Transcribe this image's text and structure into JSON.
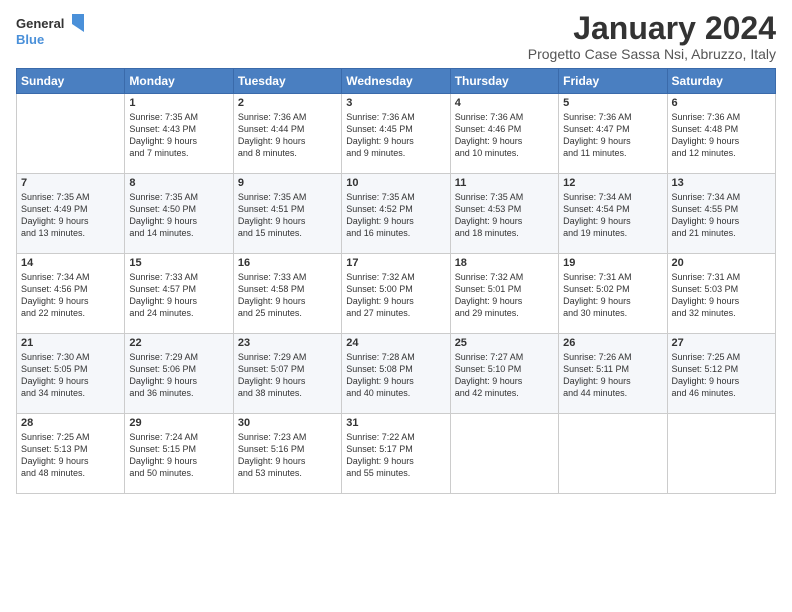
{
  "header": {
    "logo_general": "General",
    "logo_blue": "Blue",
    "title": "January 2024",
    "subtitle": "Progetto Case Sassa Nsi, Abruzzo, Italy"
  },
  "weekdays": [
    "Sunday",
    "Monday",
    "Tuesday",
    "Wednesday",
    "Thursday",
    "Friday",
    "Saturday"
  ],
  "weeks": [
    [
      {
        "day": "",
        "info": ""
      },
      {
        "day": "1",
        "info": "Sunrise: 7:35 AM\nSunset: 4:43 PM\nDaylight: 9 hours\nand 7 minutes."
      },
      {
        "day": "2",
        "info": "Sunrise: 7:36 AM\nSunset: 4:44 PM\nDaylight: 9 hours\nand 8 minutes."
      },
      {
        "day": "3",
        "info": "Sunrise: 7:36 AM\nSunset: 4:45 PM\nDaylight: 9 hours\nand 9 minutes."
      },
      {
        "day": "4",
        "info": "Sunrise: 7:36 AM\nSunset: 4:46 PM\nDaylight: 9 hours\nand 10 minutes."
      },
      {
        "day": "5",
        "info": "Sunrise: 7:36 AM\nSunset: 4:47 PM\nDaylight: 9 hours\nand 11 minutes."
      },
      {
        "day": "6",
        "info": "Sunrise: 7:36 AM\nSunset: 4:48 PM\nDaylight: 9 hours\nand 12 minutes."
      }
    ],
    [
      {
        "day": "7",
        "info": "Sunrise: 7:35 AM\nSunset: 4:49 PM\nDaylight: 9 hours\nand 13 minutes."
      },
      {
        "day": "8",
        "info": "Sunrise: 7:35 AM\nSunset: 4:50 PM\nDaylight: 9 hours\nand 14 minutes."
      },
      {
        "day": "9",
        "info": "Sunrise: 7:35 AM\nSunset: 4:51 PM\nDaylight: 9 hours\nand 15 minutes."
      },
      {
        "day": "10",
        "info": "Sunrise: 7:35 AM\nSunset: 4:52 PM\nDaylight: 9 hours\nand 16 minutes."
      },
      {
        "day": "11",
        "info": "Sunrise: 7:35 AM\nSunset: 4:53 PM\nDaylight: 9 hours\nand 18 minutes."
      },
      {
        "day": "12",
        "info": "Sunrise: 7:34 AM\nSunset: 4:54 PM\nDaylight: 9 hours\nand 19 minutes."
      },
      {
        "day": "13",
        "info": "Sunrise: 7:34 AM\nSunset: 4:55 PM\nDaylight: 9 hours\nand 21 minutes."
      }
    ],
    [
      {
        "day": "14",
        "info": "Sunrise: 7:34 AM\nSunset: 4:56 PM\nDaylight: 9 hours\nand 22 minutes."
      },
      {
        "day": "15",
        "info": "Sunrise: 7:33 AM\nSunset: 4:57 PM\nDaylight: 9 hours\nand 24 minutes."
      },
      {
        "day": "16",
        "info": "Sunrise: 7:33 AM\nSunset: 4:58 PM\nDaylight: 9 hours\nand 25 minutes."
      },
      {
        "day": "17",
        "info": "Sunrise: 7:32 AM\nSunset: 5:00 PM\nDaylight: 9 hours\nand 27 minutes."
      },
      {
        "day": "18",
        "info": "Sunrise: 7:32 AM\nSunset: 5:01 PM\nDaylight: 9 hours\nand 29 minutes."
      },
      {
        "day": "19",
        "info": "Sunrise: 7:31 AM\nSunset: 5:02 PM\nDaylight: 9 hours\nand 30 minutes."
      },
      {
        "day": "20",
        "info": "Sunrise: 7:31 AM\nSunset: 5:03 PM\nDaylight: 9 hours\nand 32 minutes."
      }
    ],
    [
      {
        "day": "21",
        "info": "Sunrise: 7:30 AM\nSunset: 5:05 PM\nDaylight: 9 hours\nand 34 minutes."
      },
      {
        "day": "22",
        "info": "Sunrise: 7:29 AM\nSunset: 5:06 PM\nDaylight: 9 hours\nand 36 minutes."
      },
      {
        "day": "23",
        "info": "Sunrise: 7:29 AM\nSunset: 5:07 PM\nDaylight: 9 hours\nand 38 minutes."
      },
      {
        "day": "24",
        "info": "Sunrise: 7:28 AM\nSunset: 5:08 PM\nDaylight: 9 hours\nand 40 minutes."
      },
      {
        "day": "25",
        "info": "Sunrise: 7:27 AM\nSunset: 5:10 PM\nDaylight: 9 hours\nand 42 minutes."
      },
      {
        "day": "26",
        "info": "Sunrise: 7:26 AM\nSunset: 5:11 PM\nDaylight: 9 hours\nand 44 minutes."
      },
      {
        "day": "27",
        "info": "Sunrise: 7:25 AM\nSunset: 5:12 PM\nDaylight: 9 hours\nand 46 minutes."
      }
    ],
    [
      {
        "day": "28",
        "info": "Sunrise: 7:25 AM\nSunset: 5:13 PM\nDaylight: 9 hours\nand 48 minutes."
      },
      {
        "day": "29",
        "info": "Sunrise: 7:24 AM\nSunset: 5:15 PM\nDaylight: 9 hours\nand 50 minutes."
      },
      {
        "day": "30",
        "info": "Sunrise: 7:23 AM\nSunset: 5:16 PM\nDaylight: 9 hours\nand 53 minutes."
      },
      {
        "day": "31",
        "info": "Sunrise: 7:22 AM\nSunset: 5:17 PM\nDaylight: 9 hours\nand 55 minutes."
      },
      {
        "day": "",
        "info": ""
      },
      {
        "day": "",
        "info": ""
      },
      {
        "day": "",
        "info": ""
      }
    ]
  ]
}
